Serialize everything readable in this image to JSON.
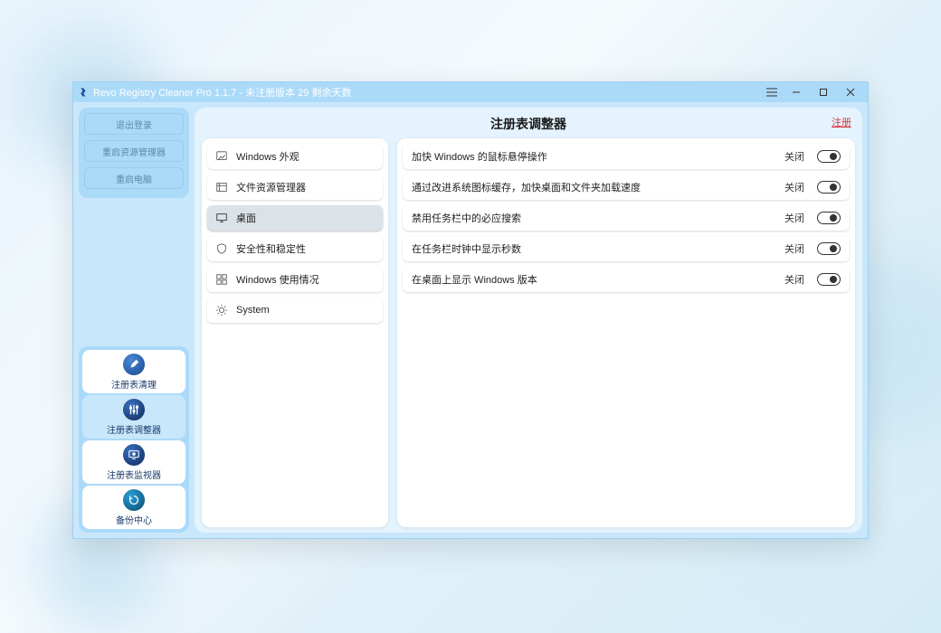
{
  "window": {
    "title": "Revo Registry Cleaner Pro 1.1.7 - 未注册版本 29 剩余天数"
  },
  "sidebar": {
    "top_buttons": [
      {
        "label": "退出登录"
      },
      {
        "label": "重启资源管理器"
      },
      {
        "label": "重启电脑"
      }
    ],
    "nav": [
      {
        "label": "注册表清理",
        "icon": "broom",
        "selected": false
      },
      {
        "label": "注册表调整器",
        "icon": "sliders",
        "selected": true
      },
      {
        "label": "注册表监视器",
        "icon": "monitor",
        "selected": false
      },
      {
        "label": "备份中心",
        "icon": "restore",
        "selected": false
      }
    ]
  },
  "main": {
    "title": "注册表调整器",
    "register_link": "注册",
    "categories": [
      {
        "label": "Windows 外观",
        "icon": "paintbrush",
        "selected": false
      },
      {
        "label": "文件资源管理器",
        "icon": "folder",
        "selected": false
      },
      {
        "label": "桌面",
        "icon": "desktop",
        "selected": true
      },
      {
        "label": "安全性和稳定性",
        "icon": "shield",
        "selected": false
      },
      {
        "label": "Windows 使用情况",
        "icon": "windows",
        "selected": false
      },
      {
        "label": "System",
        "icon": "gear",
        "selected": false
      }
    ],
    "options": [
      {
        "label": "加快 Windows 的鼠标悬停操作",
        "state": "关闭"
      },
      {
        "label": "通过改进系统图标缓存，加快桌面和文件夹加载速度",
        "state": "关闭"
      },
      {
        "label": "禁用任务栏中的必应搜索",
        "state": "关闭"
      },
      {
        "label": "在任务栏时钟中显示秒数",
        "state": "关闭"
      },
      {
        "label": "在桌面上显示 Windows 版本",
        "state": "关闭"
      }
    ]
  }
}
